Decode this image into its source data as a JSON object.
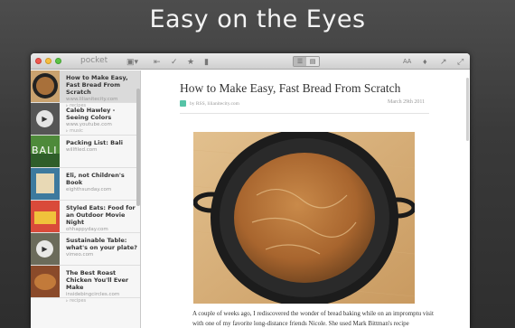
{
  "banner": {
    "headline": "Easy on the Eyes"
  },
  "window": {
    "app_title": "pocket",
    "toolbar": {
      "archive_icon": "box-icon",
      "back_icon": "back-arrow-icon",
      "mark_read_icon": "checkmark-icon",
      "favorite_icon": "star-icon",
      "delete_icon": "trash-icon",
      "font_label": "AA",
      "tag_icon": "tag-icon",
      "share_icon": "share-icon",
      "expand_icon": "expand-icon"
    },
    "list": [
      {
        "title": "How to Make Easy, Fast Bread From Scratch",
        "source": "www.lilianitecity.com",
        "tag": "recipes",
        "thumb": "bread",
        "selected": true
      },
      {
        "title": "Caleb Hawley - Seeing Colors",
        "source": "www.youtube.com",
        "tag": "music",
        "thumb": "video"
      },
      {
        "title": "Packing List: Bali",
        "source": "willfiled.com",
        "tag": "",
        "thumb": "bali",
        "thumb_text": "BALI"
      },
      {
        "title": "Eli, not Children's Book",
        "source": "eighthsunday.com",
        "tag": "",
        "thumb": "book"
      },
      {
        "title": "Styled Eats: Food for an Outdoor Movie Night",
        "source": "ohhappyday.com",
        "tag": "",
        "thumb": "food"
      },
      {
        "title": "Sustainable Table: what's on your plate?",
        "source": "vimeo.com",
        "tag": "",
        "thumb": "video2"
      },
      {
        "title": "The Best Roast Chicken You'll Ever Make",
        "source": "insidebingcircles.com",
        "tag": "recipes",
        "thumb": "chicken"
      }
    ],
    "article": {
      "title": "How to Make Easy, Fast Bread From Scratch",
      "byline": "by RSS, lilianitecity.com",
      "date": "March 29th 2011",
      "body": "A couple of weeks ago, I rediscovered the wonder of bread baking while on an impromptu visit with one of my favorite long-distance friends Nicole. She used Mark Bittman's recipe"
    }
  }
}
